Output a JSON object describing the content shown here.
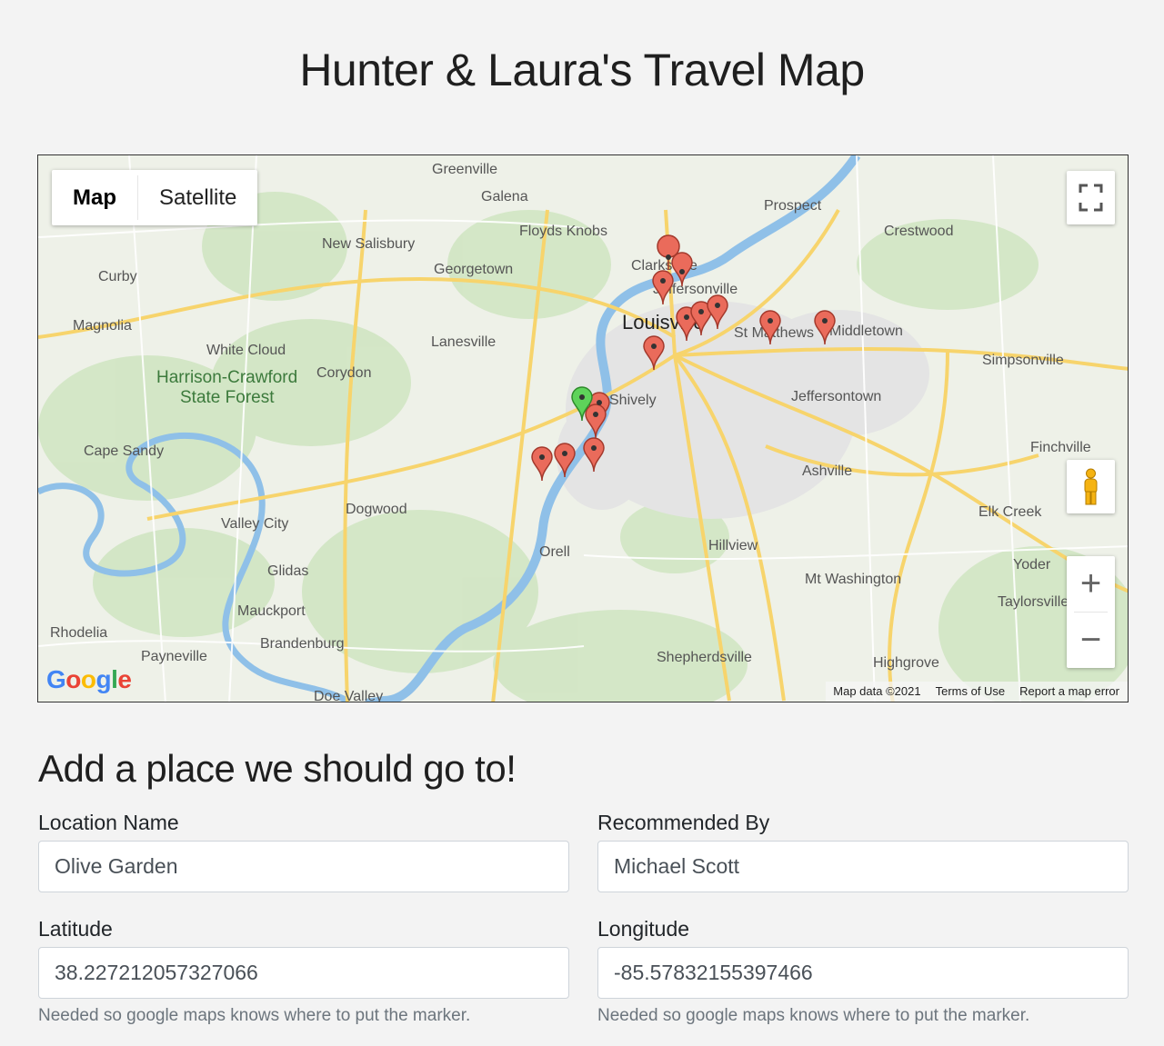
{
  "title": "Hunter & Laura's Travel Map",
  "map": {
    "type_buttons": {
      "map": "Map",
      "satellite": "Satellite"
    },
    "zoom_in": "+",
    "zoom_out": "−",
    "logo": "Google",
    "footer": {
      "data": "Map data ©2021",
      "terms": "Terms of Use",
      "report": "Report a map error"
    },
    "place_labels": [
      "Greenville",
      "Galena",
      "Floyds Knobs",
      "Prospect",
      "Crestwood",
      "New Salisbury",
      "Georgetown",
      "Curby",
      "Magnolia",
      "White Cloud",
      "Harrison-Crawford",
      "State Forest",
      "Corydon",
      "Lanesville",
      "Louisville",
      "St Matthews",
      "Middletown",
      "Simpsonville",
      "Jeffersontown",
      "Shively",
      "Cape Sandy",
      "Valley City",
      "Dogwood",
      "Glidas",
      "Mauckport",
      "Rhodelia",
      "Payneville",
      "Brandenburg",
      "Doe Valley",
      "Orell",
      "Hillview",
      "Mt Washington",
      "Shepherdsville",
      "Highgrove",
      "Ashville",
      "Finchville",
      "Elk Creek",
      "Yoder",
      "Taylorsville",
      "Clarksville",
      "Jeffersonville"
    ],
    "colors": {
      "marker_red": "#ea6b5b",
      "marker_green": "#5ed35a",
      "river": "#8fc0e8",
      "road": "#f7d46c",
      "park": "#cfe5c1"
    }
  },
  "form": {
    "heading": "Add a place we should go to!",
    "location_name": {
      "label": "Location Name",
      "value": "Olive Garden"
    },
    "recommended_by": {
      "label": "Recommended By",
      "value": "Michael Scott"
    },
    "latitude": {
      "label": "Latitude",
      "value": "38.227212057327066",
      "help": "Needed so google maps knows where to put the marker."
    },
    "longitude": {
      "label": "Longitude",
      "value": "-85.57832155397466",
      "help": "Needed so google maps knows where to put the marker."
    }
  }
}
